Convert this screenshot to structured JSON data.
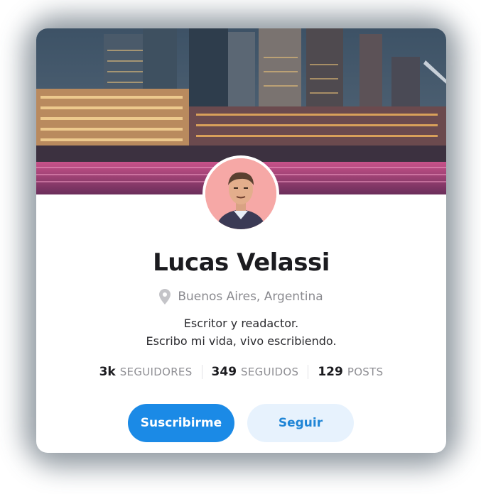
{
  "profile": {
    "name": "Lucas Velassi",
    "location": "Buenos Aires, Argentina",
    "bio_line1": "Escritor y readactor.",
    "bio_line2": "Escribo mi vida, vivo escribiendo."
  },
  "stats": [
    {
      "value": "3k",
      "label": "SEGUIDORES"
    },
    {
      "value": "349",
      "label": "SEGUIDOS"
    },
    {
      "value": "129",
      "label": "POSTS"
    }
  ],
  "actions": {
    "subscribe_label": "Suscribirme",
    "follow_label": "Seguir"
  },
  "colors": {
    "primary": "#1b8ae6",
    "secondary_bg": "#e7f2fd",
    "secondary_text": "#1f85d6"
  },
  "icons": {
    "location": "map-pin-icon"
  }
}
